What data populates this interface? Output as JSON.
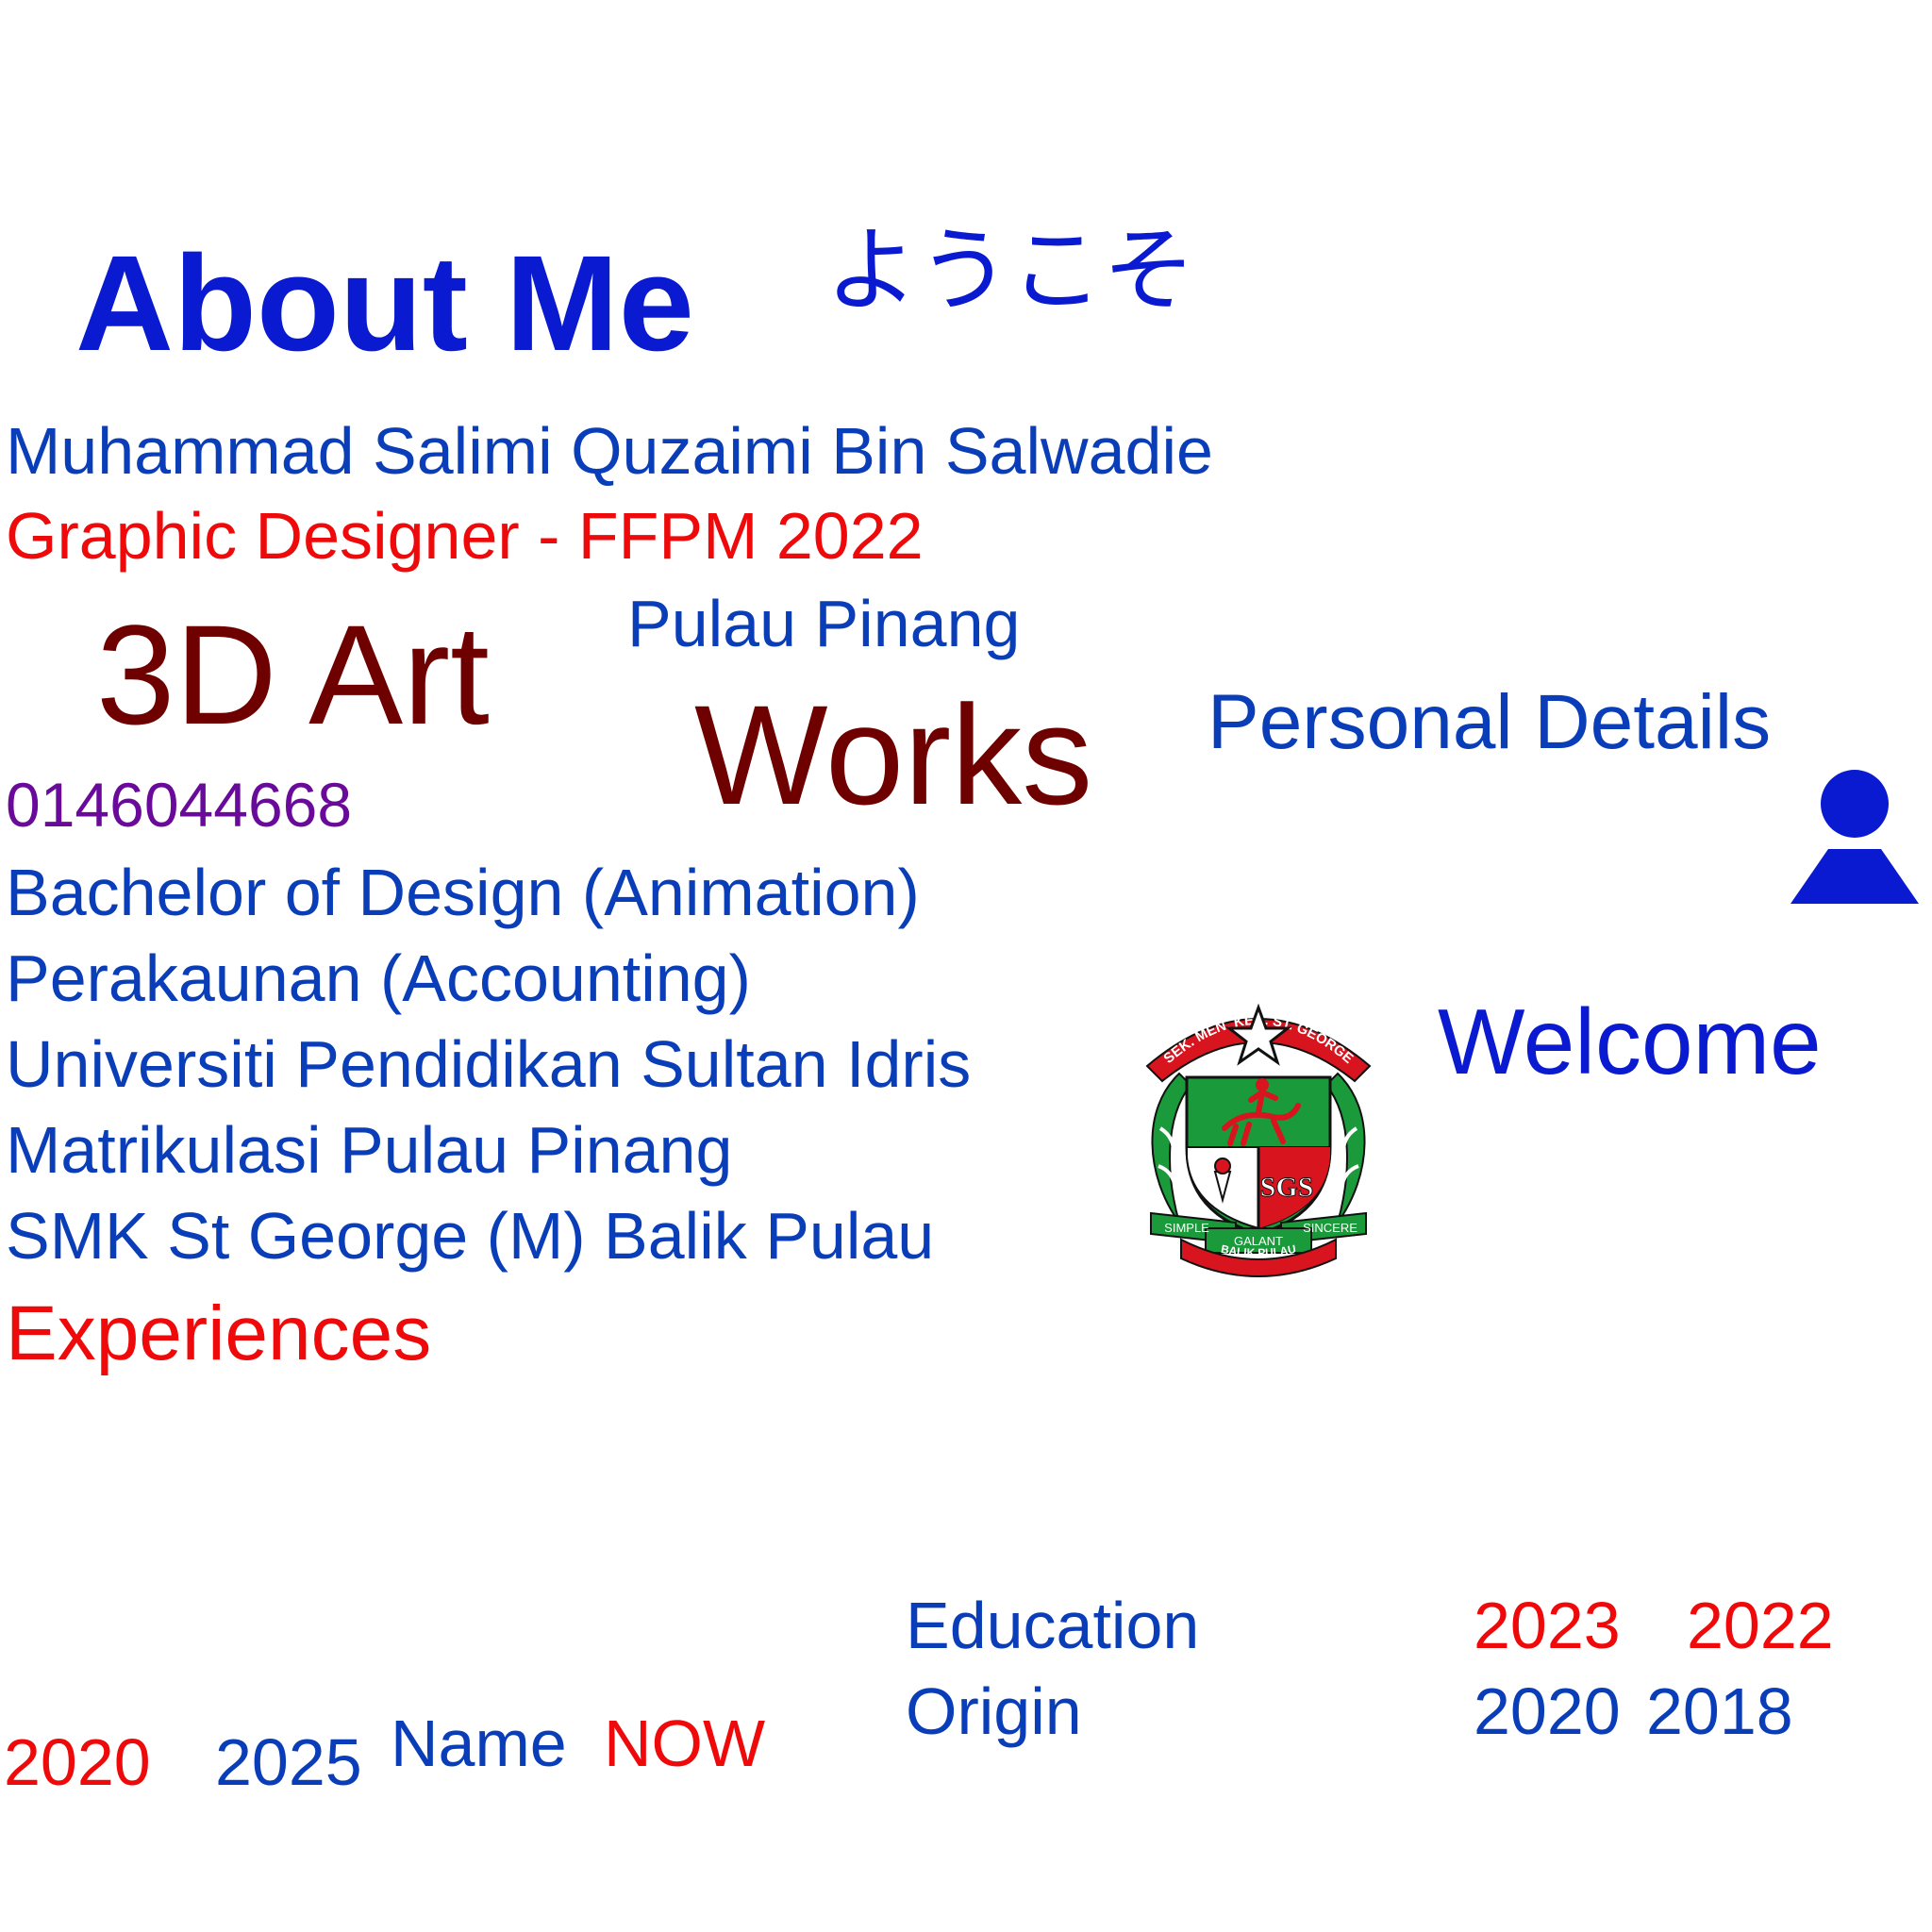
{
  "about": {
    "title": "About Me",
    "greeting_jp": "ようこそ",
    "full_name": "Muhammad Salimi Quzaimi Bin Salwadie",
    "role": "Graphic Designer - FFPM 2022",
    "location": "Pulau Pinang",
    "phone": "0146044668",
    "welcome": "Welcome"
  },
  "headings": {
    "art_3d": "3D Art",
    "works": "Works",
    "personal_details": "Personal Details",
    "experiences": "Experiences"
  },
  "education": {
    "degree": "Bachelor of Design (Animation)",
    "diploma": "Perakaunan (Accounting)",
    "university": "Universiti Pendidikan Sultan Idris",
    "matriculation": "Matrikulasi Pulau Pinang",
    "school": "SMK St George (M) Balik Pulau"
  },
  "timeline": {
    "education_label": "Education",
    "origin_label": "Origin",
    "name_label": "Name",
    "now_label": "NOW",
    "years": {
      "y2020_red": "2020",
      "y2025": "2025",
      "y2023": "2023",
      "y2022": "2022",
      "y2020_blue": "2020",
      "y2018": "2018"
    }
  },
  "crest": {
    "banner_top": "SEK. MEN. KEB. ST. GEORGE",
    "monogram": "SGS",
    "motto_left": "SIMPLE",
    "motto_right": "SINCERE",
    "motto_center": "GALANT",
    "banner_bottom": "BALIK PULAU"
  },
  "colors": {
    "heading_blue": "#0a1ad0",
    "text_blue": "#0a3db8",
    "accent_red": "#ee0a0a",
    "maroon": "#6e0000",
    "phone_purple": "#6a0a9a",
    "crest_green": "#1a9a3a",
    "crest_red": "#d8141e"
  },
  "icons": {
    "profile": "user-icon",
    "school": "school-crest-icon"
  }
}
